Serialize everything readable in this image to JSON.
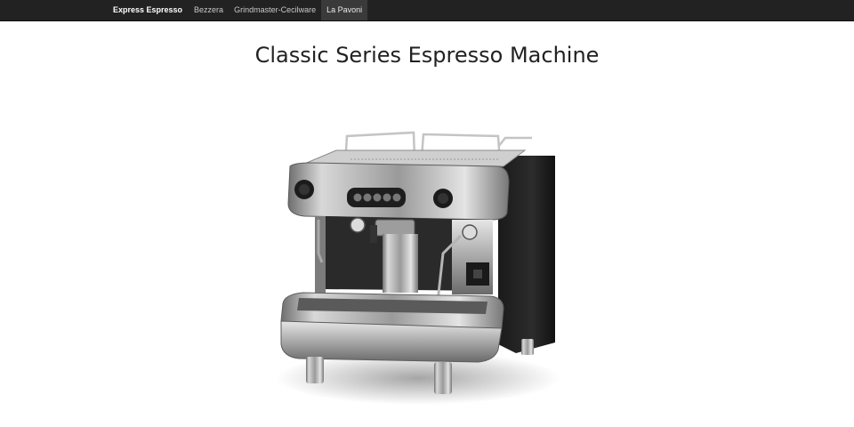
{
  "navbar": {
    "brand": "Express Espresso",
    "items": [
      {
        "label": "Bezzera",
        "active": false
      },
      {
        "label": "Grindmaster-Cecilware",
        "active": false
      },
      {
        "label": "La Pavoni",
        "active": true
      }
    ]
  },
  "main": {
    "title": "Classic Series Espresso Machine"
  },
  "colors": {
    "navbar_bg": "#222222",
    "active_bg": "#3a3a3a",
    "title": "#222222"
  }
}
